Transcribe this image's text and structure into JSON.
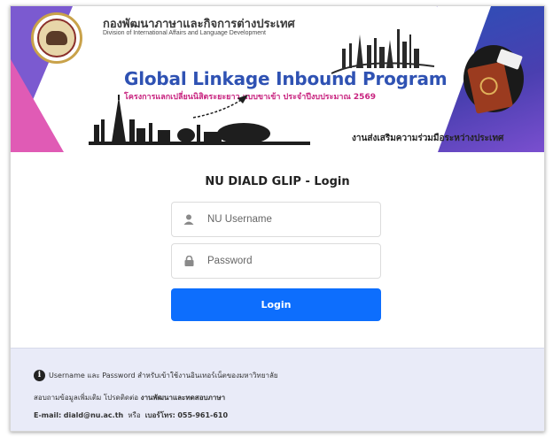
{
  "banner": {
    "org_name_th": "กองพัฒนาภาษาและกิจการต่างประเทศ",
    "org_name_en": "Division of International Affairs and Language Development",
    "program_title": "Global Linkage Inbound Program",
    "program_subtitle_th": "โครงการแลกเปลี่ยนนิสิตระยะยาว แบบขาเข้า ประจำปีงบประมาณ 2569",
    "tagline_th": "งานส่งเสริมความร่วมมือระหว่างประเทศ"
  },
  "login": {
    "title": "NU DIALD GLIP - Login",
    "username_placeholder": "NU Username",
    "password_placeholder": "Password",
    "button_label": "Login"
  },
  "footer": {
    "line1_prefix": "Username และ Password สำหรับเข้าใช้งานอินเทอร์เน็ตของมหาวิทยาลัย",
    "line2_prefix": "สอบถามข้อมูลเพิ่มเติม โปรดติดต่อ",
    "line2_bold": "งานพัฒนาและทดสอบภาษา",
    "email_label": "E-mail:",
    "email": "diald@nu.ac.th",
    "or_text": "หรือ",
    "phone_label": "เบอร์โทร:",
    "phone": "055-961-610"
  },
  "colors": {
    "primary_button": "#0d6efd",
    "program_title": "#2f52b3",
    "program_subtitle": "#c8237f",
    "footer_bg": "#e9ebf8"
  },
  "icons": [
    "university-seal",
    "user-icon",
    "lock-icon",
    "info-icon",
    "passport-image",
    "skyline-image"
  ]
}
